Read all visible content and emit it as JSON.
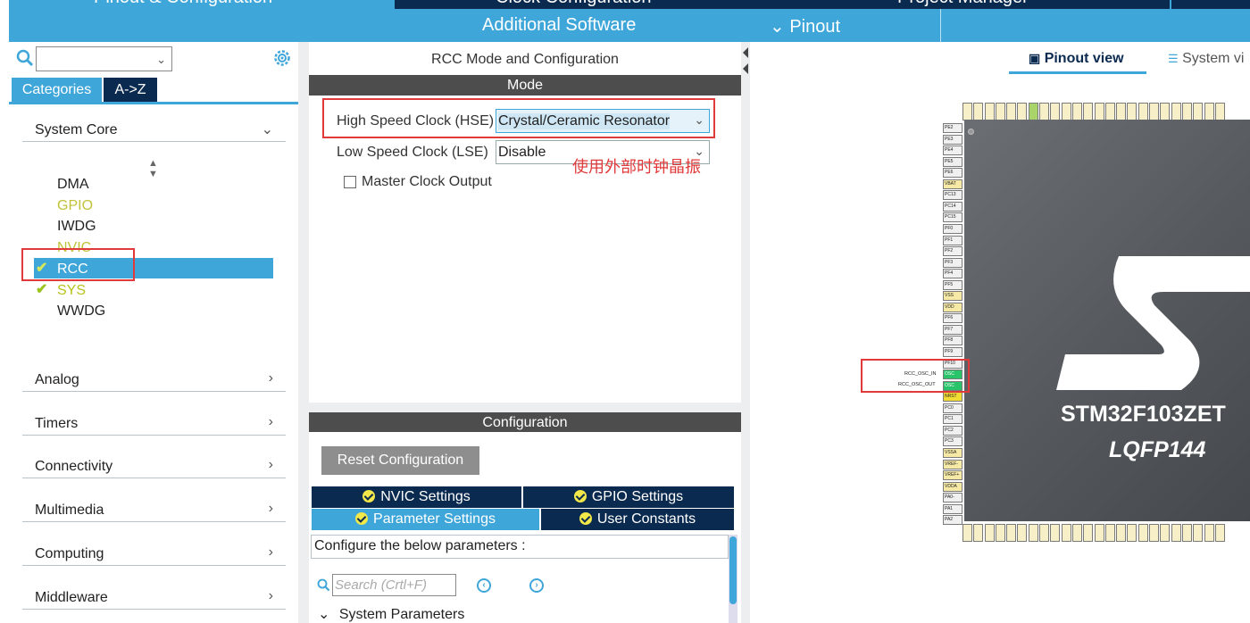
{
  "header": {
    "tabs_top": [
      "Pinout & Configuration",
      "Clock Configuration",
      "Project Manager"
    ],
    "additional_software": "Additional Software",
    "pinout_menu": "Pinout"
  },
  "left": {
    "search_placeholder": "",
    "tab_categories": "Categories",
    "tab_az": "A->Z",
    "system_core": "System Core",
    "system_core_items": [
      "DMA",
      "GPIO",
      "IWDG",
      "NVIC",
      "RCC",
      "SYS",
      "WWDG"
    ],
    "categories": [
      "Analog",
      "Timers",
      "Connectivity",
      "Multimedia",
      "Computing",
      "Middleware"
    ]
  },
  "mode": {
    "panel_title": "RCC Mode and Configuration",
    "section": "Mode",
    "hse_label": "High Speed Clock (HSE)",
    "hse_value": "Crystal/Ceramic Resonator",
    "lse_label": "Low Speed Clock (LSE)",
    "lse_value": "Disable",
    "mco_label": "Master Clock Output",
    "annotation": "使用外部时钟晶振"
  },
  "config": {
    "section": "Configuration",
    "reset_button": "Reset Configuration",
    "tabs": [
      "NVIC Settings",
      "GPIO Settings",
      "Parameter Settings",
      "User Constants"
    ],
    "instructions": "Configure the below parameters :",
    "search_placeholder": "Search (Crtl+F)",
    "group": "System Parameters"
  },
  "pinout": {
    "view_tab": "Pinout view",
    "system_view_tab": "System vi",
    "chip_name": "STM32F103ZET",
    "package": "LQFP144",
    "left_pins": [
      "PE2",
      "PE3",
      "PE4",
      "PE5",
      "PE6",
      "VBAT",
      "PC13",
      "PC14",
      "PC15",
      "PF0",
      "PF1",
      "PF2",
      "PF3",
      "PF4",
      "PF5",
      "VSS",
      "VDD",
      "PF6",
      "PF7",
      "PF8",
      "PF9",
      "PF10",
      "OSC",
      "OSC",
      "NRST",
      "PC0",
      "PC1",
      "PC2",
      "PC3",
      "VSSA",
      "VREF-",
      "VREF+",
      "VDDA",
      "PA0-",
      "PA1",
      "PA2"
    ],
    "osc_in_label": "RCC_OSC_IN",
    "osc_out_label": "RCC_OSC_OUT"
  },
  "colors": {
    "accent": "#3fa6da",
    "navy": "#0b2a4f",
    "highlight_red": "#e03a3a",
    "check_green": "#9ac31c"
  }
}
